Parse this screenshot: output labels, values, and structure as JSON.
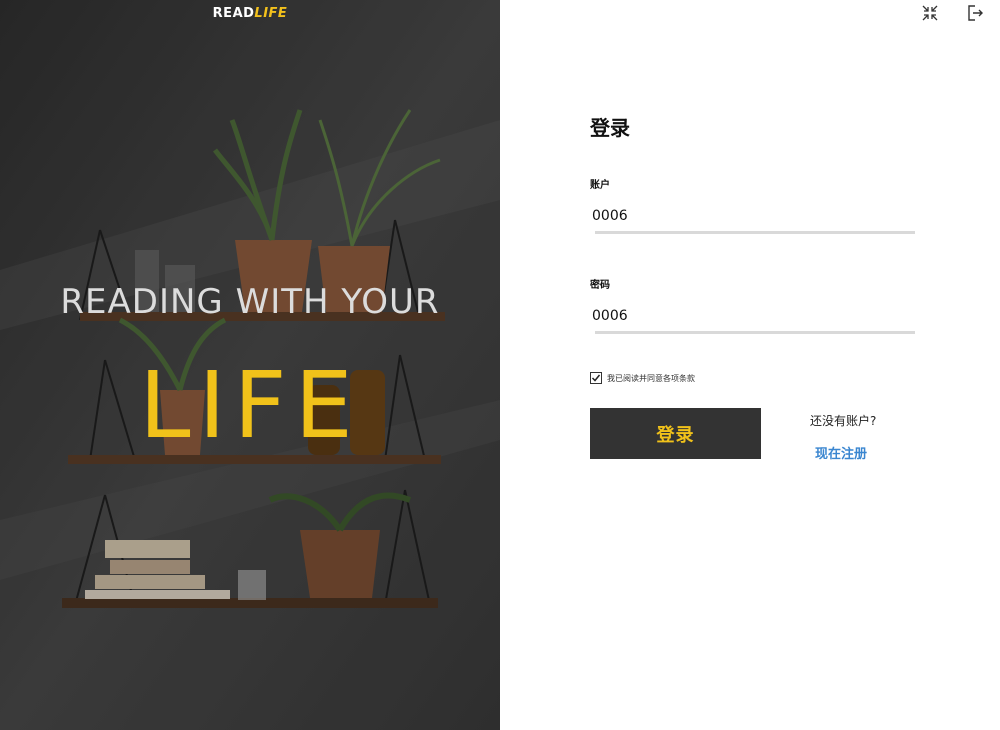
{
  "brand": {
    "prefix": "READ",
    "accent": "LIFE"
  },
  "hero": {
    "tagline": "READING WITH YOUR",
    "tagline_big": "LIFE"
  },
  "window_controls": {
    "minimize_icon": "compress-icon",
    "exit_icon": "logout-icon"
  },
  "login": {
    "title": "登录",
    "account_label": "账户",
    "account_value": "0006",
    "password_label": "密码",
    "password_value": "0006",
    "agree_checked": true,
    "agree_text": "我已阅读并同意各项条款",
    "submit_label": "登录",
    "no_account_text": "还没有账户?",
    "register_link": "现在注册"
  },
  "colors": {
    "accent_yellow": "#f1c21a",
    "button_dark": "#333333",
    "link_blue": "#3a86d0",
    "hero_bg": "#3f3f3f"
  }
}
